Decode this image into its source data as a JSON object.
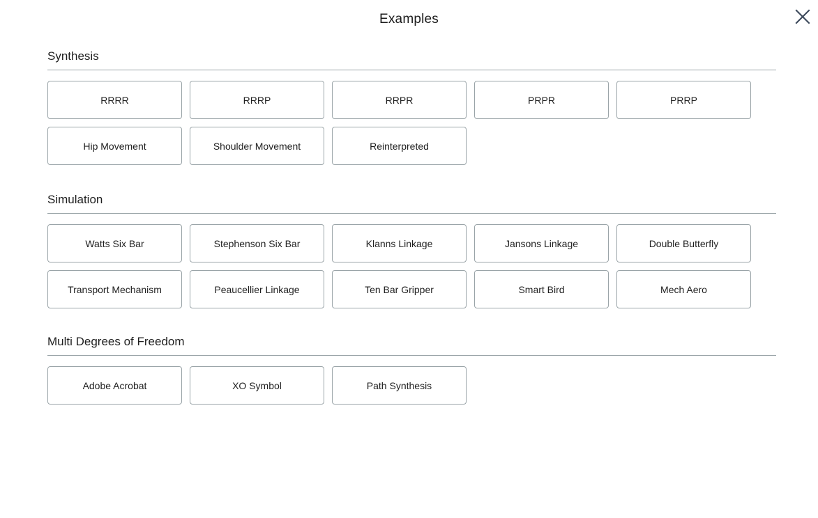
{
  "header": {
    "title": "Examples",
    "close_icon": "close-icon"
  },
  "theme": {
    "background": "#ffffff",
    "text": "#1f1f1f",
    "border": "#9aa4a8",
    "close_icon_color": "#3d4a5c"
  },
  "sections": [
    {
      "id": "synthesis",
      "title": "Synthesis",
      "buttons": [
        "RRRR",
        "RRRP",
        "RRPR",
        "PRPR",
        "PRRP",
        "Hip Movement",
        "Shoulder Movement",
        "Reinterpreted"
      ]
    },
    {
      "id": "simulation",
      "title": "Simulation",
      "buttons": [
        "Watts Six Bar",
        "Stephenson Six Bar",
        "Klanns Linkage",
        "Jansons Linkage",
        "Double Butterfly",
        "Transport Mechanism",
        "Peaucellier Linkage",
        "Ten Bar Gripper",
        "Smart Bird",
        "Mech Aero"
      ]
    },
    {
      "id": "multidof",
      "title": "Multi Degrees of Freedom",
      "buttons": [
        "Adobe Acrobat",
        "XO Symbol",
        "Path Synthesis"
      ]
    }
  ]
}
